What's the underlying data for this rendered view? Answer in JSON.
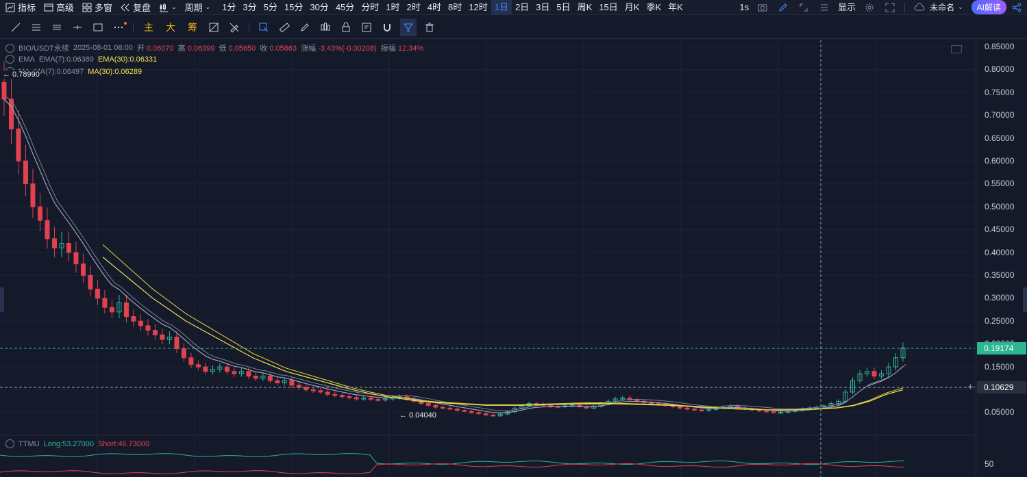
{
  "toolbar_top": {
    "left_items": [
      {
        "label": "指标",
        "icon": "indicator-icon"
      },
      {
        "label": "高级",
        "icon": "advanced-chart-icon"
      },
      {
        "label": "多窗",
        "icon": "multi-window-icon"
      },
      {
        "label": "复盘",
        "icon": "replay-icon"
      }
    ],
    "chart_type_icon": "candlestick-type-icon",
    "period_label": "周期",
    "periods": [
      "1分",
      "3分",
      "5分",
      "15分",
      "30分",
      "45分",
      "分时",
      "1时",
      "2时",
      "4时",
      "8时",
      "12时",
      "1日",
      "2日",
      "3日",
      "5日",
      "周K",
      "15日",
      "月K",
      "季K",
      "年K"
    ],
    "active_period": "1日",
    "right": {
      "interval": "1s",
      "display_label": "显示",
      "layout_label": "未命名",
      "ai_label": "AI解读"
    }
  },
  "toolbar_drawing": {
    "tools": [
      "trend-line-icon",
      "horizontal-lines-icon",
      "parallel-lines-icon",
      "ray-icon",
      "rectangle-icon",
      "more-icon"
    ],
    "labels": {
      "main": "主",
      "big": "大",
      "chip": "筹"
    },
    "right_tools": [
      "zoom-select-icon",
      "ruler-icon",
      "pen-icon",
      "pattern-icon",
      "lock-icon",
      "note-icon",
      "magnet-icon",
      "filter-icon",
      "trash-icon"
    ]
  },
  "legend": {
    "symbol": "BIO/USDT永续",
    "datetime": "2025-08-01 08:00",
    "open_label": "开",
    "open": "0.06070",
    "high_label": "高",
    "high": "0.06399",
    "low_label": "低",
    "low": "0.05650",
    "close_label": "收",
    "close": "0.05863",
    "change_label": "涨幅",
    "change": "-3.43%(-0.00208)",
    "amp_label": "振幅",
    "amp": "12.34%",
    "ema_name": "EMA",
    "ema7": "EMA(7):0.06389",
    "ema30": "EMA(30):0.06331",
    "ma_name": "MA",
    "ma7": "MA(7):0.06497",
    "ma30": "MA(30):0.06289",
    "ttmu_name": "TTMU",
    "ttmu_long": "Long:53.27000",
    "ttmu_short": "Short:46.73000"
  },
  "annotations": {
    "high_mark": "← 0.78990",
    "low_mark": "← 0.04040"
  },
  "price_axis": {
    "labels": [
      "0.85000",
      "0.80000",
      "0.75000",
      "0.70000",
      "0.65000",
      "0.60000",
      "0.55000",
      "0.50000",
      "0.45000",
      "0.40000",
      "0.35000",
      "0.30000",
      "0.25000",
      "0.20000",
      "0.15000",
      "0.10000",
      "0.05000"
    ],
    "current_price": "0.19174",
    "crosshair_price": "0.10629",
    "sub_label": "50"
  },
  "colors": {
    "up": "#2db594",
    "down": "#e0424f",
    "ema7": "#9ea3b8",
    "ema30": "#f0e14a",
    "ttmu_long": "#2db594",
    "ttmu_short": "#e0424f",
    "background": "#151a2b"
  },
  "chart_data": {
    "type": "candlestick",
    "ylim": [
      0.02,
      0.86
    ],
    "closes": [
      0.735,
      0.67,
      0.6,
      0.55,
      0.5,
      0.47,
      0.43,
      0.41,
      0.42,
      0.4,
      0.375,
      0.35,
      0.32,
      0.3,
      0.28,
      0.27,
      0.29,
      0.26,
      0.25,
      0.24,
      0.23,
      0.22,
      0.21,
      0.215,
      0.19,
      0.17,
      0.155,
      0.15,
      0.14,
      0.145,
      0.15,
      0.14,
      0.135,
      0.14,
      0.13,
      0.125,
      0.13,
      0.12,
      0.115,
      0.12,
      0.11,
      0.105,
      0.1,
      0.098,
      0.095,
      0.09,
      0.088,
      0.085,
      0.083,
      0.08,
      0.082,
      0.079,
      0.078,
      0.08,
      0.083,
      0.085,
      0.08,
      0.075,
      0.07,
      0.066,
      0.062,
      0.06,
      0.058,
      0.055,
      0.053,
      0.05,
      0.048,
      0.045,
      0.043,
      0.047,
      0.052,
      0.06,
      0.065,
      0.07,
      0.068,
      0.066,
      0.064,
      0.063,
      0.065,
      0.067,
      0.063,
      0.06,
      0.064,
      0.07,
      0.075,
      0.08,
      0.082,
      0.078,
      0.075,
      0.072,
      0.07,
      0.068,
      0.066,
      0.063,
      0.06,
      0.058,
      0.056,
      0.055,
      0.057,
      0.06,
      0.062,
      0.065,
      0.06,
      0.058,
      0.056,
      0.054,
      0.052,
      0.05,
      0.051,
      0.053,
      0.055,
      0.058,
      0.06,
      0.062,
      0.065,
      0.07,
      0.075,
      0.095,
      0.12,
      0.135,
      0.14,
      0.13,
      0.135,
      0.15,
      0.17,
      0.19174
    ],
    "ema30": [
      0.39,
      0.36,
      0.33,
      0.3,
      0.275,
      0.25,
      0.23,
      0.21,
      0.19,
      0.17,
      0.155,
      0.14,
      0.13,
      0.12,
      0.11,
      0.1,
      0.092,
      0.085,
      0.08,
      0.075,
      0.072,
      0.07,
      0.068,
      0.066,
      0.066,
      0.066,
      0.067,
      0.068,
      0.069,
      0.07,
      0.07,
      0.069,
      0.068,
      0.067,
      0.066,
      0.064,
      0.062,
      0.06,
      0.058,
      0.057,
      0.056,
      0.056,
      0.057,
      0.058,
      0.06,
      0.065,
      0.075,
      0.09,
      0.1
    ],
    "ttmu": {
      "long": 53.27,
      "short": 46.73
    }
  }
}
